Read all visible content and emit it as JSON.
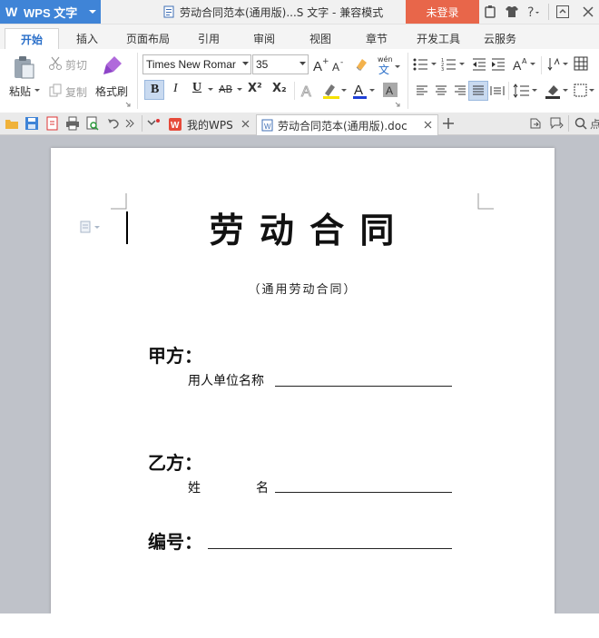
{
  "app": {
    "name": "WPS 文字",
    "logo": "W"
  },
  "window": {
    "title": "劳动合同范本(通用版)...S 文字 - 兼容模式",
    "login_label": "未登录"
  },
  "tabs": [
    {
      "label": "开始",
      "active": true
    },
    {
      "label": "插入"
    },
    {
      "label": "页面布局"
    },
    {
      "label": "引用"
    },
    {
      "label": "审阅"
    },
    {
      "label": "视图"
    },
    {
      "label": "章节"
    },
    {
      "label": "开发工具"
    },
    {
      "label": "云服务"
    }
  ],
  "ribbon": {
    "paste_label": "粘贴",
    "cut_label": "剪切",
    "copy_label": "复制",
    "format_painter_label": "格式刷",
    "font_name": "Times New Romar",
    "font_size": "35",
    "bold": "B",
    "italic": "I",
    "underline": "U",
    "strike": "AB",
    "superscript": "X²",
    "subscript": "X₂",
    "wen": "wén",
    "wen_char": "文"
  },
  "doc_tabs": [
    {
      "label": "我的WPS",
      "active": false
    },
    {
      "label": "劳动合同范本(通用版).doc",
      "active": true
    }
  ],
  "document": {
    "title": "劳 动 合 同",
    "subtitle": "（通用劳动合同）",
    "party_a": "甲方：",
    "party_a_field": "用人单位名称",
    "party_b": "乙方：",
    "party_b_field_1": "姓",
    "party_b_field_2": "名",
    "number": "编号："
  },
  "colors": {
    "app_blue": "#3f84d7",
    "login_orange": "#e8664a",
    "active_tab_text": "#2a6fc9",
    "workspace_gray": "#bfc2c9"
  }
}
